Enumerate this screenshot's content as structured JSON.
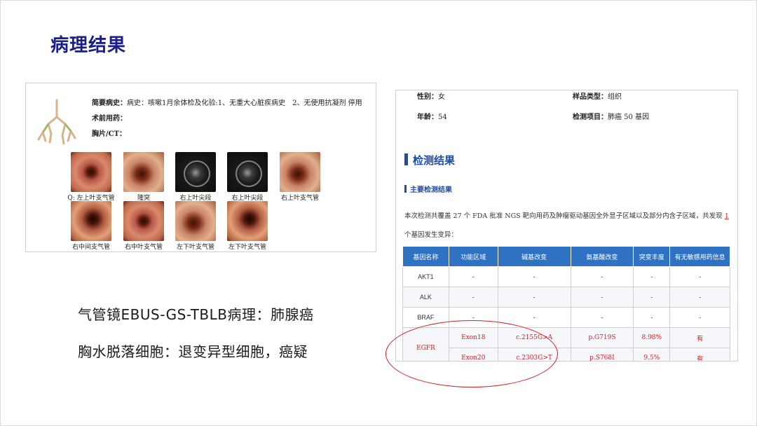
{
  "title": "病理结果",
  "left_panel": {
    "history_label": "简要病史：",
    "history_text": "病史：咳嗽1月余体检及化验:1、无重大心脏疾病史　2、无使用抗凝剂 停用",
    "pre_op_label": "术前用药：",
    "chest_label": "胸片/CT：",
    "thumbnails": [
      {
        "label": "Q: 左上叶支气管",
        "kind": "endo"
      },
      {
        "label": "隆突",
        "kind": "endo2"
      },
      {
        "label": "右上叶尖段",
        "kind": "us"
      },
      {
        "label": "右上叶尖段",
        "kind": "us"
      },
      {
        "label": "右上叶支气管",
        "kind": "endo2"
      },
      {
        "label": "右中间支气管",
        "kind": "endo3"
      },
      {
        "label": "右中叶支气管",
        "kind": "endo"
      },
      {
        "label": "左下叶支气管",
        "kind": "endo2"
      },
      {
        "label": "左下叶支气管",
        "kind": "endo3"
      }
    ]
  },
  "report": {
    "sex_label": "性别：",
    "sex_value": "女",
    "sample_label": "样品类型：",
    "sample_value": "组织",
    "age_label": "年龄：",
    "age_value": "54",
    "item_label": "检测项目：",
    "item_value": "肺癌 50 基因",
    "section_title": "检测结果",
    "sub_title": "主要检测结果",
    "summary_pre": "本次检测共覆盖 27 个 FDA 批准 NGS 靶向用药及肿瘤驱动基因全外显子区域以及部分内含子区域，共发现",
    "summary_count": "1",
    "summary_post": "个基因发生变异：",
    "table": {
      "headers": [
        "基因名称",
        "功能区域",
        "碱基改变",
        "氨基酸改变",
        "突变丰度",
        "有无敏感用药信息"
      ],
      "rows": [
        [
          "AKT1",
          "-",
          "-",
          "-",
          "-",
          "-"
        ],
        [
          "ALK",
          "-",
          "-",
          "-",
          "-",
          "-"
        ],
        [
          "BRAF",
          "-",
          "-",
          "-",
          "-",
          "-"
        ]
      ],
      "egfr_gene": "EGFR",
      "egfr_rows": [
        [
          "Exon18",
          "c.2155G>A",
          "p.G719S",
          "8.98%",
          "有"
        ],
        [
          "Exon20",
          "c.2303G>T",
          "p.S768I",
          "9.5%",
          "有"
        ]
      ]
    }
  },
  "captions": {
    "line1": "气管镜EBUS-GS-TBLB病理：肺腺癌",
    "line2": "胸水脱落细胞：退变异型细胞，癌疑"
  },
  "colors": {
    "title": "#1a1f8a",
    "accent_blue": "#1f4aa8",
    "table_header": "#2f72c4",
    "mutation_red": "#d32020"
  }
}
